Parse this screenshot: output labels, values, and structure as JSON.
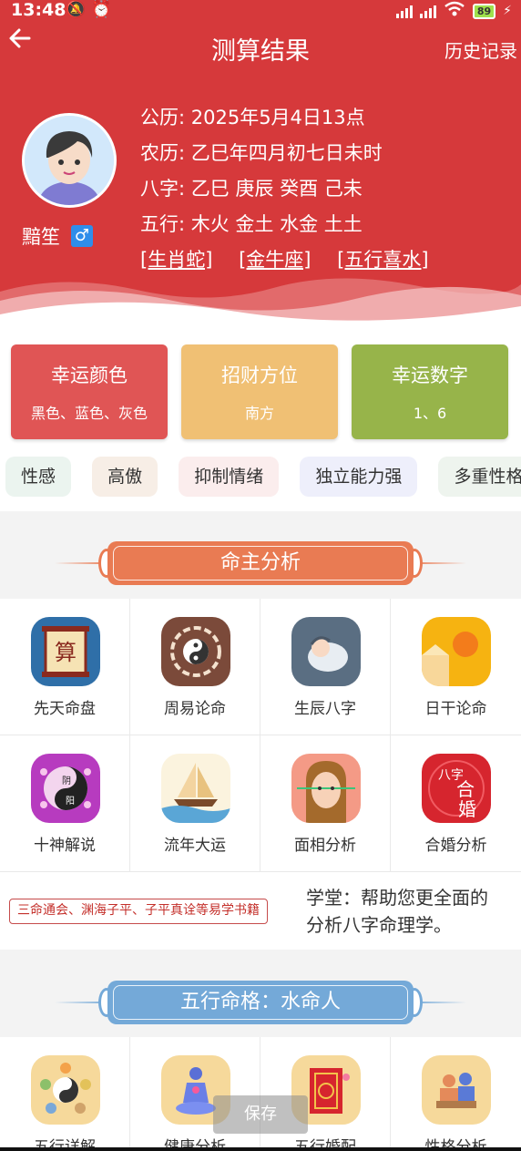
{
  "status": {
    "time": "13:48",
    "battery": "89"
  },
  "topbar": {
    "title": "测算结果",
    "history": "历史记录"
  },
  "user": {
    "name": "黯笙",
    "gender_symbol": "♂"
  },
  "info": {
    "solar": "公历: 2025年5月4日13点",
    "lunar": "农历: 乙巳年四月初七日未时",
    "bazi": "八字: 乙巳  庚辰  癸酉  己未",
    "wuxing": "五行: 木火  金土  水金  土土",
    "tags": [
      "[生肖蛇]",
      "[金牛座]",
      "[五行喜水]"
    ]
  },
  "cards": [
    {
      "title": "幸运颜色",
      "value": "黑色、蓝色、灰色",
      "color": "#e05555"
    },
    {
      "title": "招财方位",
      "value": "南方",
      "color": "#f0c074"
    },
    {
      "title": "幸运数字",
      "value": "1、6",
      "color": "#97b44a"
    }
  ],
  "traits": [
    {
      "label": "性感",
      "bg": "#ebf4ef"
    },
    {
      "label": "高傲",
      "bg": "#f7eee6"
    },
    {
      "label": "抑制情绪",
      "bg": "#fbeded"
    },
    {
      "label": "独立能力强",
      "bg": "#eeeffb"
    },
    {
      "label": "多重性格",
      "bg": "#eef4ee"
    }
  ],
  "section1": {
    "title": "命主分析",
    "color": "#e97b53"
  },
  "items1": [
    {
      "label": "先天命盘",
      "icon": "abacus-scroll-icon"
    },
    {
      "label": "周易论命",
      "icon": "yin-yang-icon"
    },
    {
      "label": "生辰八字",
      "icon": "baby-icon"
    },
    {
      "label": "日干论命",
      "icon": "sun-icon"
    },
    {
      "label": "十神解说",
      "icon": "yin-yang-circle-icon"
    },
    {
      "label": "流年大运",
      "icon": "sailboat-icon"
    },
    {
      "label": "面相分析",
      "icon": "face-scan-icon"
    },
    {
      "label": "合婚分析",
      "icon": "double-happiness-icon"
    }
  ],
  "school": {
    "books": "三命通会、渊海子平、子平真诠等易学书籍",
    "desc_line1": "学堂：帮助您更全面的",
    "desc_line2": "分析八字命理学。"
  },
  "section2": {
    "title": "五行命格：水命人",
    "color": "#74a9d8"
  },
  "items2": [
    {
      "label": "五行详解",
      "icon": "five-elements-icon"
    },
    {
      "label": "健康分析",
      "icon": "meditation-icon"
    },
    {
      "label": "五行婚配",
      "icon": "wedding-card-icon"
    },
    {
      "label": "性格分析",
      "icon": "people-desk-icon"
    }
  ],
  "save_label": "保存",
  "icon_text": {
    "suan": "算",
    "yin": "阴",
    "yang": "阳",
    "bazi_mark": "八字",
    "he": "合",
    "hun": "婚"
  }
}
